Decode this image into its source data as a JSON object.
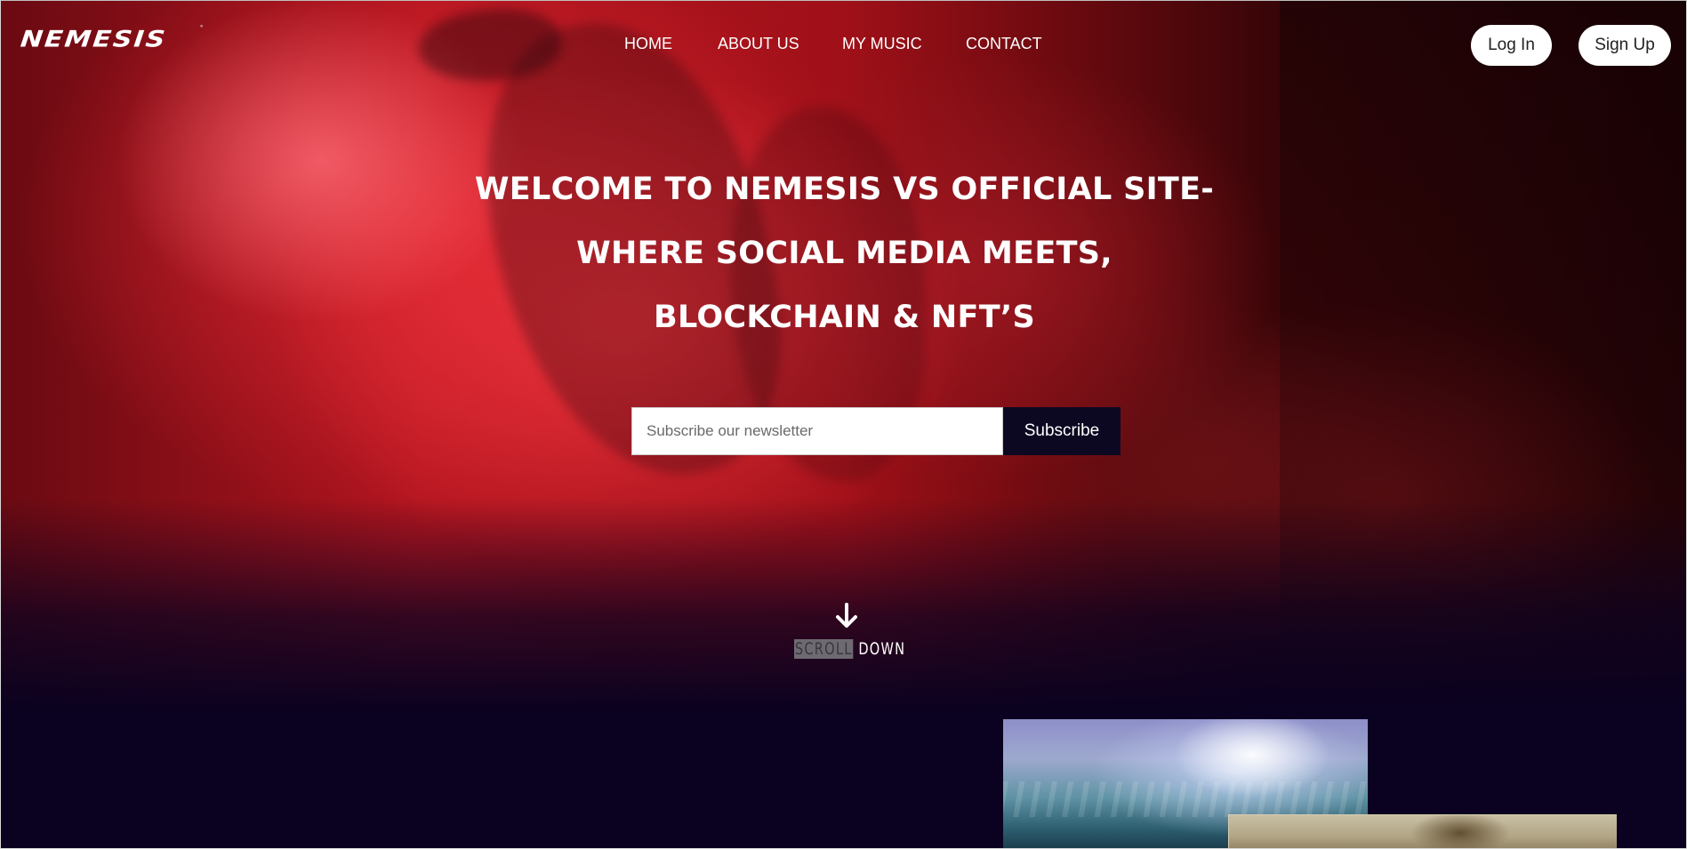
{
  "brand": {
    "logo_text": "NEMESIS",
    "logo_mark": "°"
  },
  "nav": {
    "items": [
      {
        "label": "HOME"
      },
      {
        "label": "ABOUT US"
      },
      {
        "label": "MY MUSIC"
      },
      {
        "label": "CONTACT"
      }
    ]
  },
  "auth": {
    "login_label": "Log In",
    "signup_label": "Sign Up"
  },
  "hero": {
    "headline_lines": [
      "WELCOME TO NEMESIS VS OFFICIAL SITE-",
      "WHERE SOCIAL MEDIA MEETS,",
      "BLOCKCHAIN & NFT’S"
    ]
  },
  "newsletter": {
    "placeholder": "Subscribe our newsletter",
    "value": "",
    "button_label": "Subscribe"
  },
  "scroll": {
    "label_highlighted": "SCROLL",
    "label_rest": "DOWN",
    "icon": "arrow-down-icon"
  },
  "colors": {
    "hero_red": "#c81e2a",
    "page_background": "#0a0220",
    "subscribe_button": "#0d0822",
    "text": "#ffffff"
  }
}
